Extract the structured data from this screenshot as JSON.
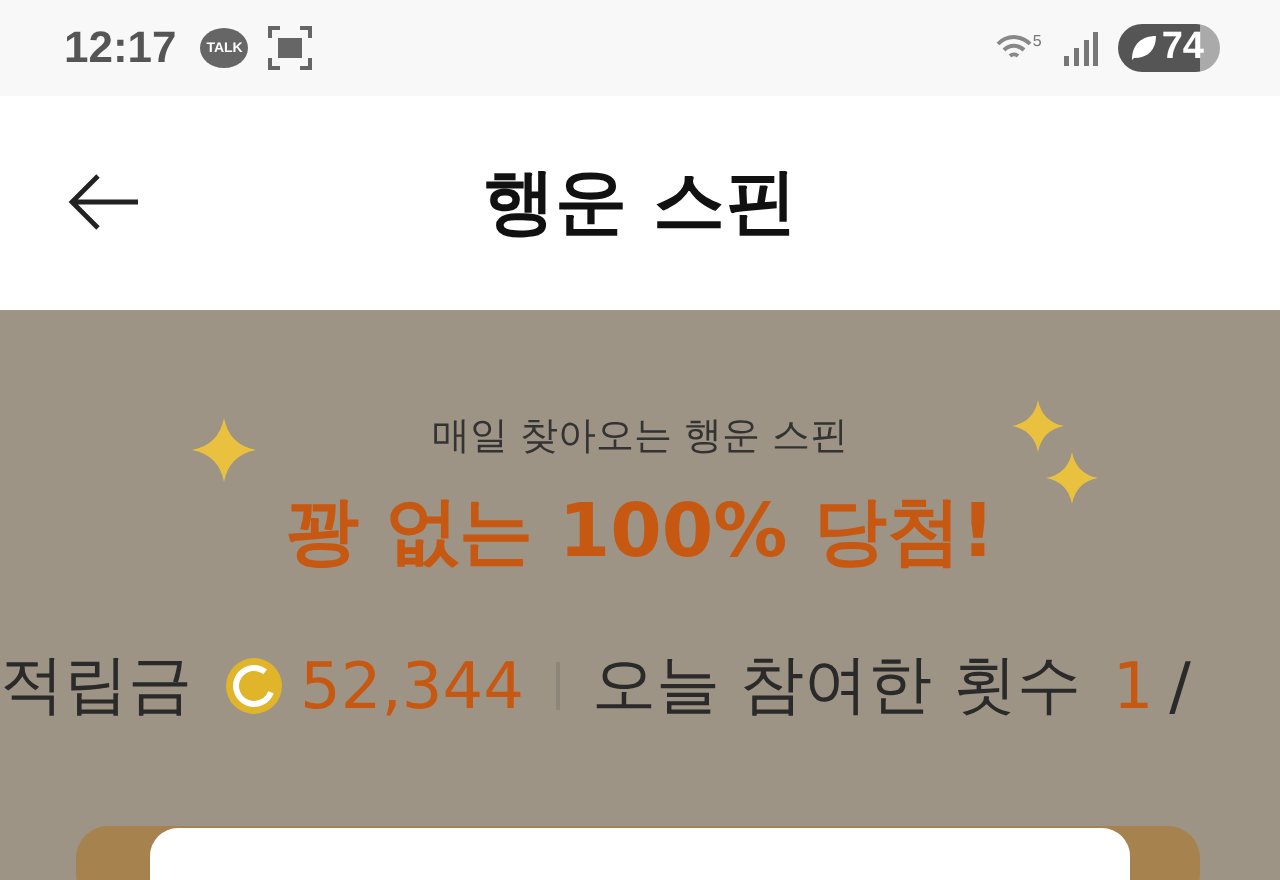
{
  "status_bar": {
    "time": "12:17",
    "talk_label": "TALK",
    "wifi_badge": "5",
    "battery": "74"
  },
  "header": {
    "title": "행운 스핀"
  },
  "banner": {
    "subtitle": "매일 찾아오는 행운 스핀",
    "headline": "꽝 없는 100% 당첨!"
  },
  "stats": {
    "points_label": "적립금",
    "points_value": "52,344",
    "count_label": "오늘 참여한 횟수",
    "count_value": "1",
    "count_separator": "/"
  }
}
